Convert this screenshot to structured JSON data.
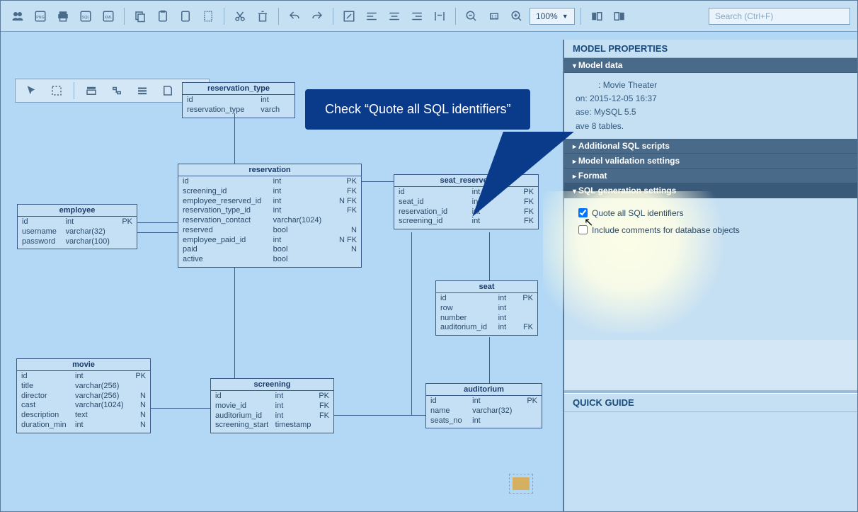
{
  "toolbar": {
    "zoom": "100%"
  },
  "search": {
    "placeholder": "Search (Ctrl+F)"
  },
  "speech": "Check “Quote all SQL identifiers”",
  "right": {
    "title": "MODEL PROPERTIES",
    "sections": {
      "model_data": "Model data",
      "additional_scripts": "Additional SQL scripts",
      "validation": "Model validation settings",
      "format": "Format",
      "sql_gen": "SQL generation settings"
    },
    "model_data_body": {
      "name": "Movie Theater",
      "on": "2015-12-05 16:37",
      "base": "MySQL 5.5",
      "tables": "8 tables."
    },
    "sql_gen": {
      "opt1": "Quote all SQL identifiers",
      "opt2": "Include comments for database objects"
    },
    "quick_guide": "QUICK GUIDE"
  },
  "tables": {
    "reservation_type": {
      "name": "reservation_type",
      "cols": [
        [
          "id",
          "int",
          ""
        ],
        [
          "reservation_type",
          "varch",
          ""
        ]
      ]
    },
    "reservation": {
      "name": "reservation",
      "cols": [
        [
          "id",
          "int",
          "PK"
        ],
        [
          "screening_id",
          "int",
          "FK"
        ],
        [
          "employee_reserved_id",
          "int",
          "N FK"
        ],
        [
          "reservation_type_id",
          "int",
          "FK"
        ],
        [
          "reservation_contact",
          "varchar(1024)",
          ""
        ],
        [
          "reserved",
          "bool",
          "N"
        ],
        [
          "employee_paid_id",
          "int",
          "N FK"
        ],
        [
          "paid",
          "bool",
          "N"
        ],
        [
          "active",
          "bool",
          ""
        ]
      ]
    },
    "seat_reserved": {
      "name": "seat_reserved",
      "cols": [
        [
          "id",
          "int",
          "PK"
        ],
        [
          "seat_id",
          "int",
          "FK"
        ],
        [
          "reservation_id",
          "int",
          "FK"
        ],
        [
          "screening_id",
          "int",
          "FK"
        ]
      ]
    },
    "employee": {
      "name": "employee",
      "cols": [
        [
          "id",
          "int",
          "PK"
        ],
        [
          "username",
          "varchar(32)",
          ""
        ],
        [
          "password",
          "varchar(100)",
          ""
        ]
      ]
    },
    "seat": {
      "name": "seat",
      "cols": [
        [
          "id",
          "int",
          "PK"
        ],
        [
          "row",
          "int",
          ""
        ],
        [
          "number",
          "int",
          ""
        ],
        [
          "auditorium_id",
          "int",
          "FK"
        ]
      ]
    },
    "movie": {
      "name": "movie",
      "cols": [
        [
          "id",
          "int",
          "PK"
        ],
        [
          "title",
          "varchar(256)",
          ""
        ],
        [
          "director",
          "varchar(256)",
          "N"
        ],
        [
          "cast",
          "varchar(1024)",
          "N"
        ],
        [
          "description",
          "text",
          "N"
        ],
        [
          "duration_min",
          "int",
          "N"
        ]
      ]
    },
    "screening": {
      "name": "screening",
      "cols": [
        [
          "id",
          "int",
          "PK"
        ],
        [
          "movie_id",
          "int",
          "FK"
        ],
        [
          "auditorium_id",
          "int",
          "FK"
        ],
        [
          "screening_start",
          "timestamp",
          ""
        ]
      ]
    },
    "auditorium": {
      "name": "auditorium",
      "cols": [
        [
          "id",
          "int",
          "PK"
        ],
        [
          "name",
          "varchar(32)",
          ""
        ],
        [
          "seats_no",
          "int",
          ""
        ]
      ]
    }
  }
}
